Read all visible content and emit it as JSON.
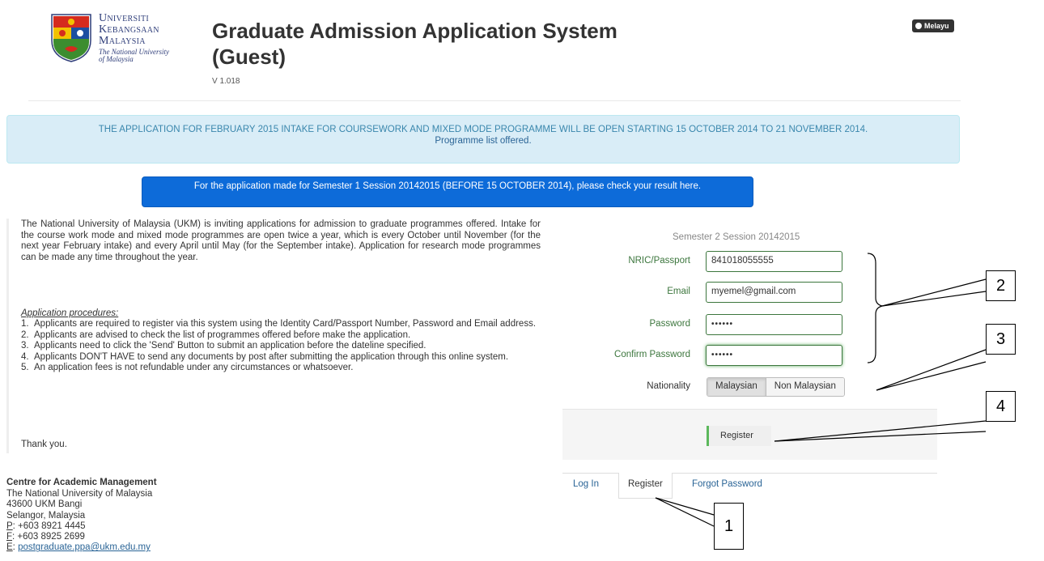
{
  "header": {
    "logo": {
      "line1": "Universiti",
      "line2": "Kebangsaan",
      "line3": "Malaysia",
      "line4": "The National University",
      "line5": "of Malaysia"
    },
    "title": "Graduate Admission Application System (Guest)",
    "version": "V 1.018",
    "language_button": "Melayu"
  },
  "notice": {
    "text": "THE APPLICATION FOR FEBRUARY 2015 INTAKE FOR COURSEWORK AND MIXED MODE PROGRAMME WILL BE OPEN STARTING 15 OCTOBER 2014 TO 21 NOVEMBER 2014.",
    "link": "Programme list offered."
  },
  "result_button": "For the application made for Semester 1 Session 20142015 (BEFORE 15 OCTOBER 2014), please check your result here.",
  "intro": {
    "paragraph": "The National University of Malaysia (UKM) is inviting applications for admission to graduate programmes offered. Intake for the course work mode and mixed mode programmes are open twice a year, which is every October until November (for the next year February intake) and every April until May (for the September intake). Application for research mode programmes can be made any time throughout the year.",
    "procedures_title": "Application procedures:",
    "procedures": [
      {
        "n": "1.",
        "t": "Applicants are required to register via this system using the Identity Card/Passport Number, Password and Email address."
      },
      {
        "n": "2.",
        "t": "Applicants are advised to check the list of programmes offered before make the application."
      },
      {
        "n": "3.",
        "t": "Applicants need to click the 'Send' Button to submit an application before the dateline specified."
      },
      {
        "n": "4.",
        "t": "Applicants DON'T HAVE to send any documents by post after submitting the application through this online system."
      },
      {
        "n": "5.",
        "t": "An application fees is not refundable under any circumstances or whatsoever."
      }
    ],
    "thanks": "Thank you."
  },
  "contact": {
    "title": "Centre for Academic Management",
    "line1": "The National University of Malaysia",
    "line2": "43600 UKM Bangi",
    "line3": "Selangor, Malaysia",
    "phone_label": "P",
    "phone": ": +603 8921 4445",
    "fax_label": "F",
    "fax": ": +603 8925 2699",
    "email_label": "E",
    "email": ": ",
    "email_link": "postgraduate.ppa@ukm.edu.my"
  },
  "form": {
    "semester": "Semester 2 Session 20142015",
    "nric_label": "NRIC/Passport",
    "nric_value": "841018055555",
    "email_label": "Email",
    "email_value": "myemel@gmail.com",
    "password_label": "Password",
    "password_value": "••••••",
    "confirm_label": "Confirm Password",
    "confirm_value": "••••••",
    "nationality_label": "Nationality",
    "nationality_options": [
      "Malaysian",
      "Non Malaysian"
    ],
    "register_button": "Register"
  },
  "tabs": [
    "Log In",
    "Register",
    "Forgot Password"
  ],
  "annotations": [
    "1",
    "2",
    "3",
    "4"
  ]
}
